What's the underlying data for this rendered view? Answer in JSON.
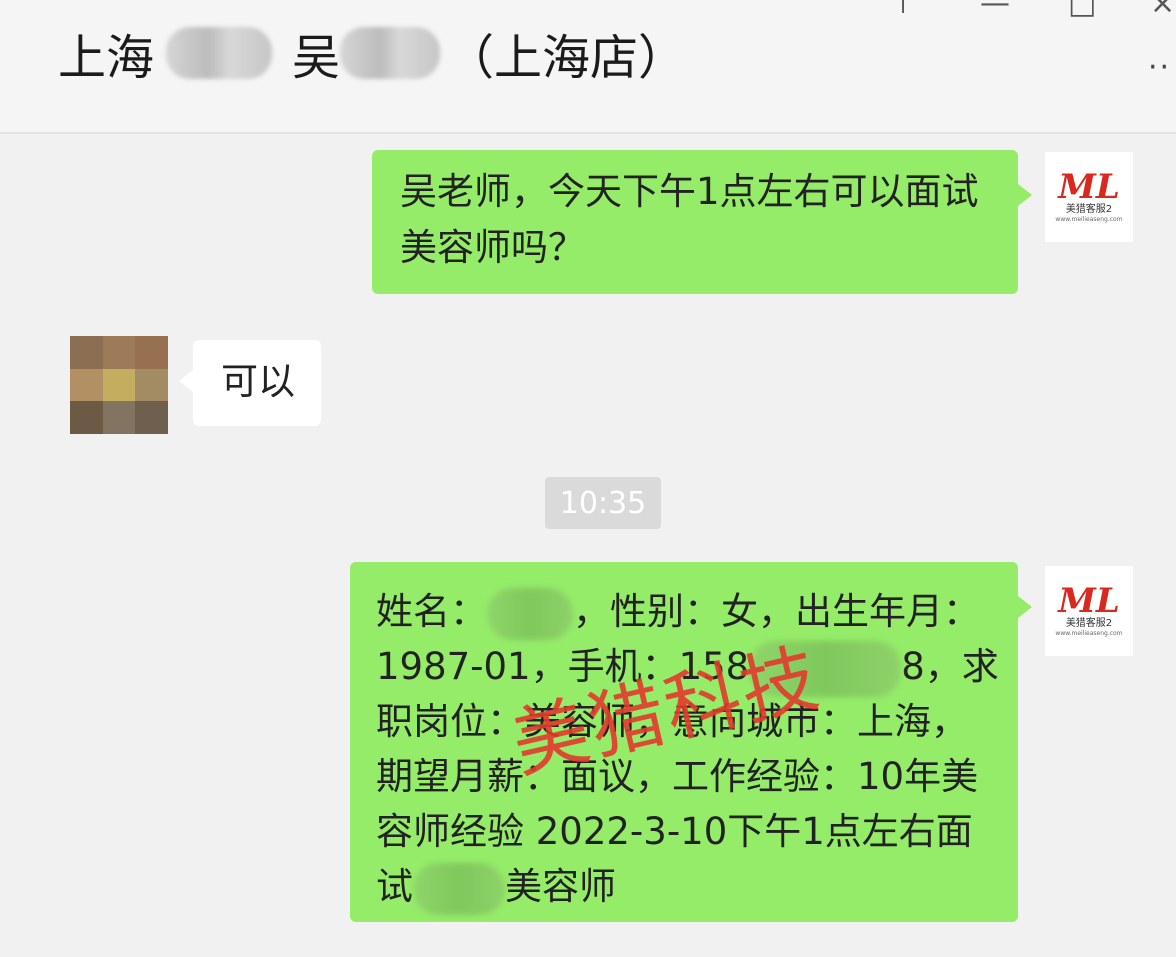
{
  "header": {
    "title_prefix": "上海",
    "title_name": "吴",
    "title_suffix": "（上海店）",
    "more_icon": "more-icon"
  },
  "avatars": {
    "self_logo_mark": "ML",
    "self_logo_text": "美猎客服2",
    "self_logo_subtext": "www.meilieaseng.com",
    "other_mosaic_colors": [
      "#8c6e52",
      "#9d7b59",
      "#96704f",
      "#b38f64",
      "#c4ad5f",
      "#a38b63",
      "#6d5a45",
      "#827460",
      "#6e5f4e"
    ]
  },
  "messages": [
    {
      "side": "right",
      "lines": [
        "吴老师，今天下午1点左右可以面试",
        "美容师吗？"
      ]
    },
    {
      "side": "left",
      "text": "可以"
    },
    {
      "side": "right",
      "line1_a": "姓名：",
      "line1_b": "，性别：女，出生年月：",
      "line2_a": "1987-01，手机：158",
      "line2_b": "8，求",
      "line3": "职岗位：美容师，意向城市：上海，",
      "line4": "期望月薪：面议，工作经验：10年美",
      "line5": "容师经验 2022-3-10下午1点左右面",
      "line6_a": "试",
      "line6_b": "美容师"
    }
  ],
  "timestamp": "10:35",
  "watermark": "美猎科技",
  "colors": {
    "bubble_green": "#95ec69",
    "bubble_white": "#ffffff",
    "background": "#f1f1f1",
    "watermark": "#e33a2e"
  }
}
